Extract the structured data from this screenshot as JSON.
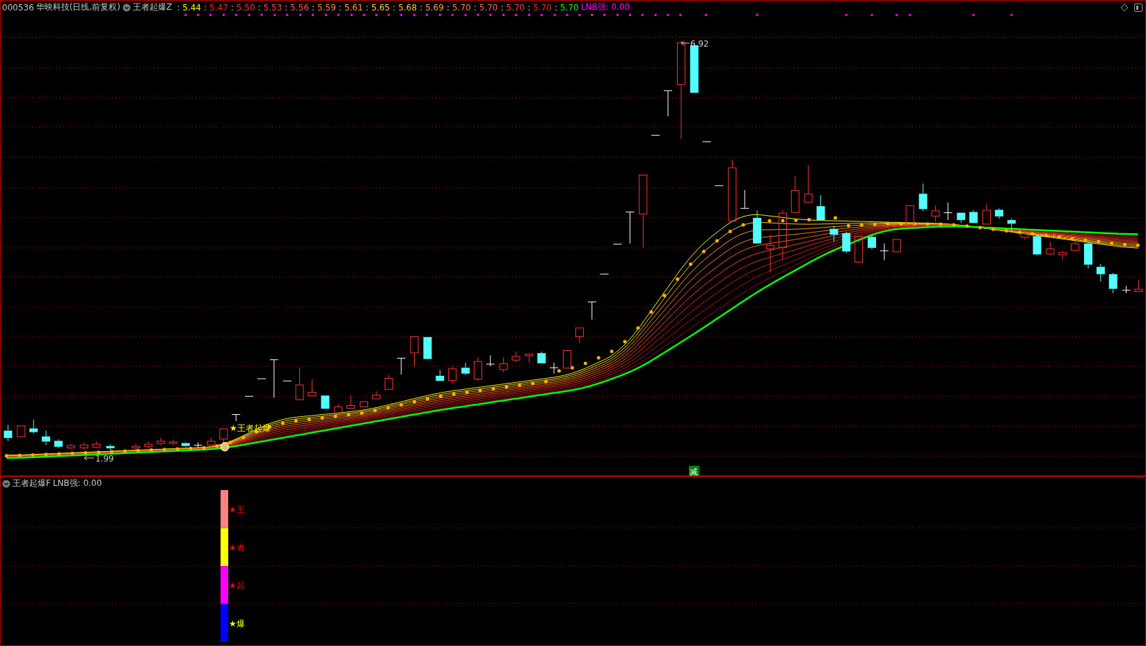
{
  "header": {
    "code": "000536",
    "title": "华映科技(日线,前复权)",
    "indicator": "王者起爆Z",
    "values": [
      {
        "separator": ":",
        "text": "5.44",
        "color": "#ffff00"
      },
      {
        "separator": ":",
        "text": "5.47",
        "color": "#ff2020"
      },
      {
        "separator": ":",
        "text": "5.50",
        "color": "#ff3030"
      },
      {
        "separator": ":",
        "text": "5.53",
        "color": "#ff4040"
      },
      {
        "separator": ":",
        "text": "5.56",
        "color": "#ff5a3c"
      },
      {
        "separator": ":",
        "text": "5.59",
        "color": "#ff8040"
      },
      {
        "separator": ":",
        "text": "5.61",
        "color": "#ffa040"
      },
      {
        "separator": ":",
        "text": "5.65",
        "color": "#ffd040"
      },
      {
        "separator": ":",
        "text": "5.68",
        "color": "#ffc040"
      },
      {
        "separator": ":",
        "text": "5.69",
        "color": "#ffa040"
      },
      {
        "separator": ":",
        "text": "5.70",
        "color": "#ff8040"
      },
      {
        "separator": ":",
        "text": "5.70",
        "color": "#ff6040"
      },
      {
        "separator": ":",
        "text": "5.70",
        "color": "#ff4040"
      },
      {
        "separator": ":",
        "text": "5.70",
        "color": "#ff2020"
      },
      {
        "separator": ":",
        "text": "5.70",
        "color": "#00ff00"
      }
    ],
    "extra": {
      "text": "LNB强: 0.00",
      "color": "#ff00ff"
    }
  },
  "main_chart": {
    "high_label": "6.92",
    "low_label": "1.99",
    "signal_label": "★王者起爆",
    "badge": "减"
  },
  "sub_panel": {
    "indicator": "王者起爆F",
    "reading": "LNB强: 0.00",
    "segments": [
      {
        "color": "#ff8080",
        "label": {
          "text": "★王",
          "color": "#ff0000"
        }
      },
      {
        "color": "#ffff00",
        "label": {
          "text": "★者",
          "color": "#ff0000"
        }
      },
      {
        "color": "#ff00ff",
        "label": {
          "text": "★起",
          "color": "#ff0000"
        }
      },
      {
        "color": "#0000ff",
        "label": {
          "text": "★爆",
          "color": "#ffff00"
        }
      }
    ]
  }
}
